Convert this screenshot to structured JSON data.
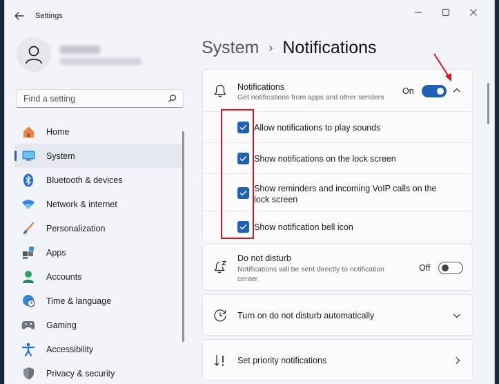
{
  "window": {
    "title": "Settings"
  },
  "profile": {
    "name": "",
    "email": ""
  },
  "search": {
    "placeholder": "Find a setting"
  },
  "sidebar": {
    "items": [
      {
        "label": "Home",
        "icon": "home-icon"
      },
      {
        "label": "System",
        "icon": "monitor-icon",
        "active": true
      },
      {
        "label": "Bluetooth & devices",
        "icon": "bluetooth-icon"
      },
      {
        "label": "Network & internet",
        "icon": "wifi-icon"
      },
      {
        "label": "Personalization",
        "icon": "brush-icon"
      },
      {
        "label": "Apps",
        "icon": "apps-icon"
      },
      {
        "label": "Accounts",
        "icon": "person-icon"
      },
      {
        "label": "Time & language",
        "icon": "globe-clock-icon"
      },
      {
        "label": "Gaming",
        "icon": "gamepad-icon"
      },
      {
        "label": "Accessibility",
        "icon": "accessibility-icon"
      },
      {
        "label": "Privacy & security",
        "icon": "shield-icon"
      }
    ]
  },
  "breadcrumb": {
    "parent": "System",
    "separator": "›",
    "current": "Notifications"
  },
  "notifications": {
    "title": "Notifications",
    "description": "Get notifications from apps and other senders",
    "toggle_label": "On",
    "toggle_state": true,
    "options": [
      {
        "label": "Allow notifications to play sounds",
        "checked": true
      },
      {
        "label": "Show notifications on the lock screen",
        "checked": true
      },
      {
        "label": "Show reminders and incoming VoIP calls on the lock screen",
        "checked": true
      },
      {
        "label": "Show notification bell icon",
        "checked": true
      }
    ]
  },
  "do_not_disturb": {
    "title": "Do not disturb",
    "description": "Notifications will be sent directly to notification center",
    "toggle_label": "Off",
    "toggle_state": false
  },
  "dnd_auto": {
    "title": "Turn on do not disturb automatically"
  },
  "priority": {
    "title": "Set priority notifications"
  },
  "colors": {
    "accent": "#1e5fb8",
    "highlight": "#d6141b",
    "window_bg": "#f3f4f9",
    "card_bg": "#fbfbfc"
  }
}
